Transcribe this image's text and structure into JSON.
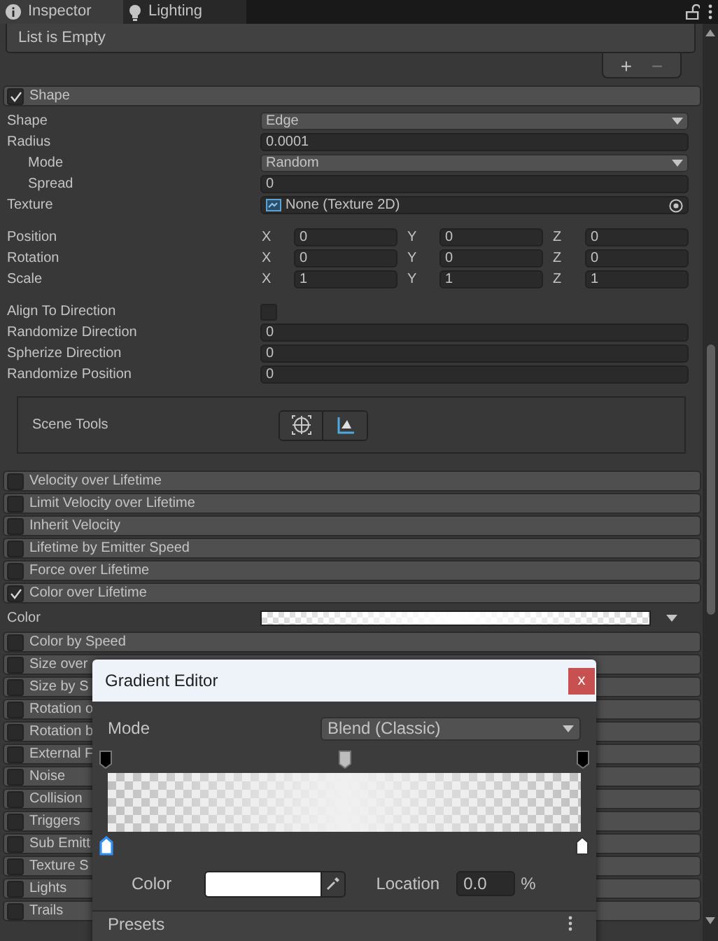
{
  "tabs": [
    {
      "label": "Inspector",
      "selected": true
    },
    {
      "label": "Lighting",
      "selected": false
    }
  ],
  "list": {
    "empty_text": "List is Empty",
    "add": "+",
    "remove": "−"
  },
  "shape_module": {
    "label": "Shape",
    "checked": true,
    "groups": [
      [
        {
          "kind": "dropdown",
          "label": "Shape",
          "value": "Edge"
        },
        {
          "kind": "number",
          "label": "Radius",
          "value": "0.0001",
          "children": [
            {
              "kind": "dropdown",
              "label": "Mode",
              "value": "Random"
            },
            {
              "kind": "number",
              "label": "Spread",
              "value": "0"
            }
          ]
        },
        {
          "kind": "object",
          "label": "Texture",
          "value": "None (Texture 2D)"
        }
      ],
      [
        {
          "kind": "vector3",
          "label": "Position",
          "axes": [
            {
              "label": "X",
              "value": "0"
            },
            {
              "label": "Y",
              "value": "0"
            },
            {
              "label": "Z",
              "value": "0"
            }
          ]
        },
        {
          "kind": "vector3",
          "label": "Rotation",
          "axes": [
            {
              "label": "X",
              "value": "0"
            },
            {
              "label": "Y",
              "value": "0"
            },
            {
              "label": "Z",
              "value": "0"
            }
          ]
        },
        {
          "kind": "vector3",
          "label": "Scale",
          "axes": [
            {
              "label": "X",
              "value": "1"
            },
            {
              "label": "Y",
              "value": "1"
            },
            {
              "label": "Z",
              "value": "1"
            }
          ]
        }
      ],
      [
        {
          "kind": "checkbox",
          "label": "Align To Direction",
          "checked": false
        },
        {
          "kind": "number",
          "label": "Randomize Direction",
          "value": "0"
        },
        {
          "kind": "number",
          "label": "Spherize Direction",
          "value": "0"
        },
        {
          "kind": "number",
          "label": "Randomize Position",
          "value": "0"
        }
      ]
    ],
    "scene_tools": {
      "label": "Scene Tools"
    }
  },
  "modules": [
    {
      "label": "Velocity over Lifetime",
      "checked": false
    },
    {
      "label": "Limit Velocity over Lifetime",
      "checked": false
    },
    {
      "label": "Inherit Velocity",
      "checked": false
    },
    {
      "label": "Lifetime by Emitter Speed",
      "checked": false
    },
    {
      "label": "Force over Lifetime",
      "checked": false
    },
    {
      "label": "Color over Lifetime",
      "checked": true,
      "properties": [
        {
          "kind": "gradient",
          "label": "Color"
        }
      ]
    },
    {
      "label": "Color by Speed",
      "checked": false
    },
    {
      "label": "Size over",
      "checked": false
    },
    {
      "label": "Size by S",
      "checked": false
    },
    {
      "label": "Rotation o",
      "checked": false
    },
    {
      "label": "Rotation b",
      "checked": false
    },
    {
      "label": "External F",
      "checked": false
    },
    {
      "label": "Noise",
      "checked": false
    },
    {
      "label": "Collision",
      "checked": false
    },
    {
      "label": "Triggers",
      "checked": false
    },
    {
      "label": "Sub Emitt",
      "checked": false
    },
    {
      "label": "Texture S",
      "checked": false
    },
    {
      "label": "Lights",
      "checked": false
    },
    {
      "label": "Trails",
      "checked": false
    }
  ],
  "gradient_editor": {
    "title": "Gradient Editor",
    "close": "x",
    "mode_label": "Mode",
    "mode": "Blend (Classic)",
    "alpha_keys": [
      {
        "color": "#000000",
        "selected": false
      },
      {
        "color": "#bdbdbd",
        "selected": false
      },
      {
        "color": "#000000",
        "selected": false
      }
    ],
    "color_keys": [
      {
        "color": "#ffffff",
        "selected": true
      },
      {
        "color": "#ffffff",
        "selected": false
      }
    ],
    "color_label": "Color",
    "location_label": "Location",
    "location": "0.0",
    "unit": "%",
    "presets": "Presets"
  }
}
